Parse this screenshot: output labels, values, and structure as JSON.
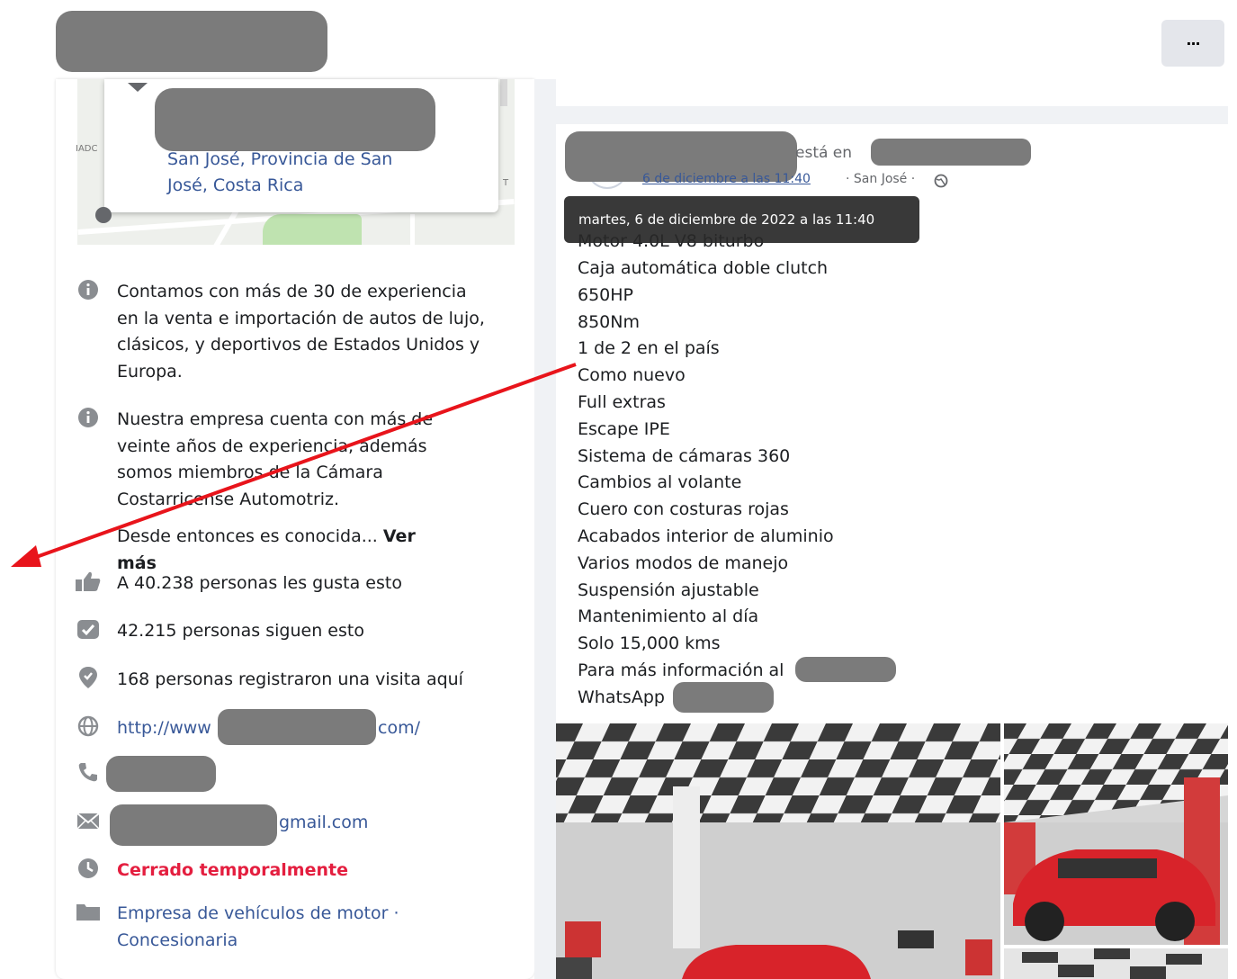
{
  "header": {
    "more_label": "···"
  },
  "map": {
    "address": "San José, Provincia de San José, Costa Rica",
    "edge_label_left": "IADC",
    "edge_label_right": "T"
  },
  "about": {
    "intro_1": "Contamos con más de 30 de experiencia en la venta e importación de autos de lujo, clásicos, y deportivos de Estados Unidos y Europa.",
    "intro_2": "Nuestra empresa cuenta con más de veinte años de experiencia, además somos miembros de la Cámara Costarricense Automotriz.",
    "intro_more": "Desde entonces es conocida...",
    "see_more": "Ver más",
    "likes": "A 40.238 personas les gusta esto",
    "follows": "42.215 personas siguen esto",
    "checkins": "168 personas registraron una visita aquí",
    "website_prefix": "http://www",
    "website_suffix": "com/",
    "email_suffix": "gmail.com",
    "status": "Cerrado temporalmente",
    "category": "Empresa de vehículos de motor · Concesionaria"
  },
  "post": {
    "author_suffix": "está en",
    "date_link": "6 de diciembre a las 11:40",
    "location": "· San José ·",
    "tooltip": "martes, 6 de diciembre de 2022 a las 11:40",
    "obscured_line": "Motor 4.0L V8 biturbo",
    "lines": [
      "Caja automática doble clutch",
      "650HP",
      "850Nm",
      "1 de 2 en el país",
      "Como nuevo",
      "Full extras",
      "Escape IPE",
      "Sistema de cámaras 360",
      "Cambios al volante",
      "Cuero con costuras rojas",
      "Acabados interior de aluminio",
      "Varios modos de manejo",
      "Suspensión ajustable",
      "Mantenimiento al día",
      "Solo 15,000 kms",
      "Para más información al",
      "WhatsApp"
    ]
  },
  "colors": {
    "link": "#385898",
    "closed": "#e41e3f",
    "icon": "#8a8d91",
    "arrow": "#e8141b",
    "redaction": "#7b7b7b",
    "car": "#d8232a"
  },
  "icons": {
    "info": "info-circle-icon",
    "like": "thumbs-up-icon",
    "follow": "checkmark-box-icon",
    "checkin": "map-pin-icon",
    "web": "globe-icon",
    "phone": "phone-icon",
    "email": "envelope-icon",
    "clock": "clock-icon",
    "category": "folder-icon",
    "privacy": "globe-privacy-icon"
  }
}
